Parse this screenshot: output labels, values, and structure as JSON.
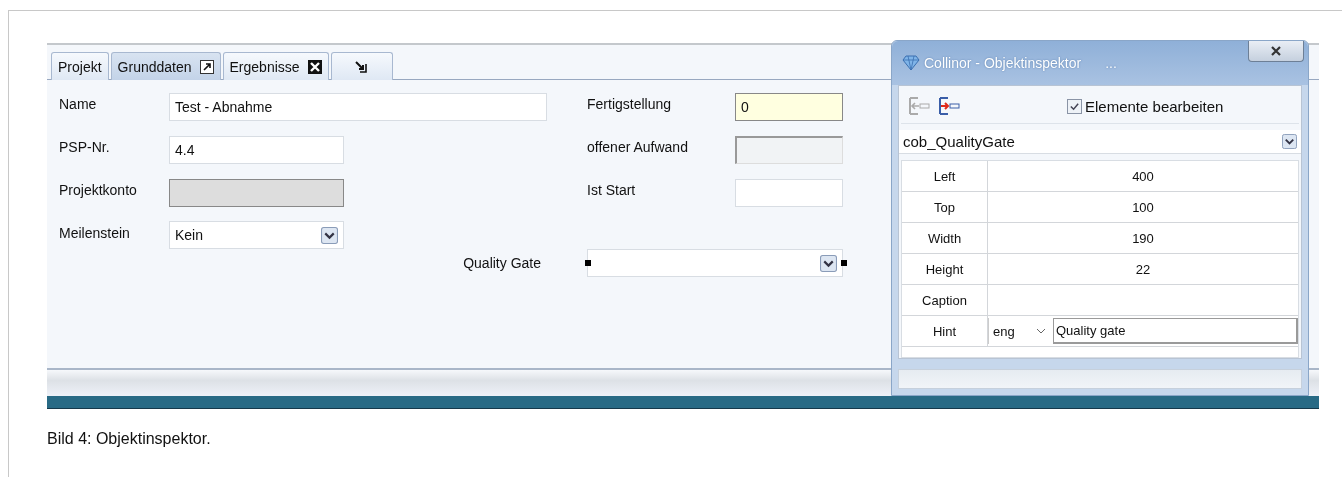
{
  "tabs": [
    {
      "label": "Projekt",
      "selected": false,
      "kind": "plain"
    },
    {
      "label": "Grunddaten",
      "selected": true,
      "kind": "detachable"
    },
    {
      "label": "Ergebnisse",
      "selected": false,
      "kind": "closable"
    },
    {
      "selected": false,
      "kind": "dock"
    }
  ],
  "form": {
    "rows": [
      {
        "left": {
          "label": "Name",
          "value": "Test - Abnahme",
          "kind": "wide"
        },
        "right": {
          "label": "Fertigstellung",
          "value": "0",
          "kind": "highlighted"
        }
      },
      {
        "left": {
          "label": "PSP-Nr.",
          "value": "4.4",
          "kind": "text"
        },
        "right": {
          "label": "offener Aufwand",
          "kind": "readonly"
        }
      },
      {
        "left": {
          "label": "Projektkonto",
          "kind": "disabled"
        },
        "right": {
          "label": "Ist Start",
          "kind": "text"
        }
      },
      {
        "left": {
          "label": "Meilenstein",
          "value": "Kein",
          "kind": "dropdown"
        },
        "right": {
          "label": "Quality Gate",
          "kind": "dropdown",
          "selected": true
        }
      }
    ]
  },
  "inspector": {
    "title": "Collinor - Objektinspektor",
    "title_suffix": "...",
    "checkbox": {
      "label": "Elemente bearbeiten",
      "checked": true
    },
    "object": "cob_QualityGate",
    "properties": [
      {
        "name": "Left",
        "value": "400",
        "kind": "text"
      },
      {
        "name": "Top",
        "value": "100",
        "kind": "text"
      },
      {
        "name": "Width",
        "value": "190",
        "kind": "text"
      },
      {
        "name": "Height",
        "value": "22",
        "kind": "text"
      },
      {
        "name": "Caption",
        "kind": "text"
      },
      {
        "name": "Hint",
        "language": "eng",
        "value": "Quality gate",
        "kind": "translated"
      }
    ]
  },
  "caption": "Bild 4: Objektinspektor."
}
